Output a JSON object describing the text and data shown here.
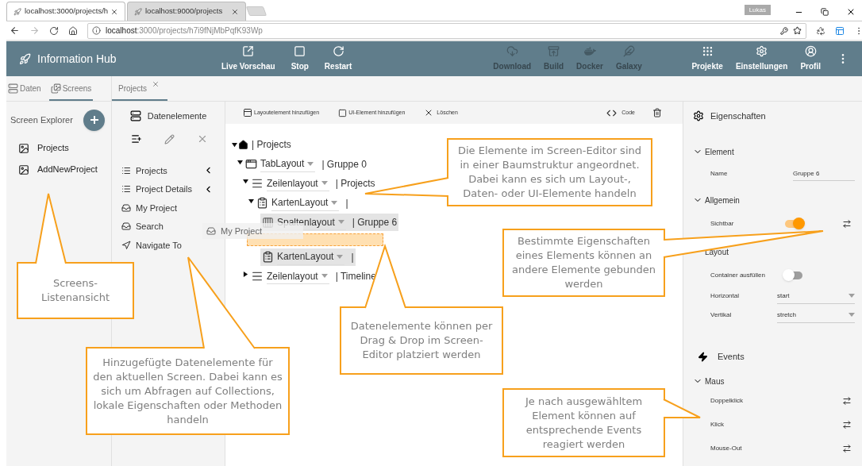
{
  "browser": {
    "tabs": [
      {
        "title": "localhost:3000/projects/h",
        "selected": true
      },
      {
        "title": "localhost:9000/projects",
        "selected": false
      }
    ],
    "profile": "Lukas",
    "url_host": "localhost",
    "url_path": ":3000/projects/h7i9fNjMbPqfK93Wp"
  },
  "app_bar": {
    "title": "Information Hub",
    "actions": [
      {
        "label": "Live Vorschau",
        "disabled": false
      },
      {
        "label": "Stop",
        "disabled": false
      },
      {
        "label": "Restart",
        "disabled": false
      },
      {
        "label": "Download",
        "disabled": true
      },
      {
        "label": "Build",
        "disabled": true
      },
      {
        "label": "Docker",
        "disabled": true
      },
      {
        "label": "Galaxy",
        "disabled": true
      },
      {
        "label": "Projekte",
        "disabled": false
      },
      {
        "label": "Einstellungen",
        "disabled": false
      },
      {
        "label": "Profil",
        "disabled": false
      }
    ]
  },
  "panel_tabs": [
    {
      "label": "Daten",
      "selected": false
    },
    {
      "label": "Screens",
      "selected": true
    }
  ],
  "editor_tabs": [
    {
      "label": "Projects",
      "selected": true
    }
  ],
  "screen_explorer": {
    "title": "Screen Explorer",
    "screens": [
      "Projects",
      "AddNewProject"
    ]
  },
  "data_elements": {
    "title": "Datenelemente",
    "items": [
      {
        "label": "Projects",
        "kind": "collection",
        "expandable": true
      },
      {
        "label": "Project Details",
        "kind": "collection",
        "expandable": true
      },
      {
        "label": "My Project",
        "kind": "object",
        "expandable": false
      },
      {
        "label": "Search",
        "kind": "object",
        "expandable": false
      },
      {
        "label": "Navigate To",
        "kind": "method",
        "expandable": false
      }
    ],
    "drag_ghost": "My Project"
  },
  "editor_toolbar": [
    "Layoutelement hinzufügen",
    "UI-Element hinzufügen",
    "Löschen",
    "Code"
  ],
  "tree": {
    "kind": "root",
    "label": "| Projects",
    "expanded": true,
    "children": [
      {
        "kind": "tab",
        "type": "TabLayout",
        "suffix": "| Gruppe 0",
        "expanded": true,
        "highlighted": false,
        "children": [
          {
            "kind": "rows",
            "type": "Zeilenlayout",
            "suffix": "| Projects",
            "expanded": true,
            "highlighted": false,
            "children": [
              {
                "kind": "card",
                "type": "KartenLayout",
                "suffix": "|",
                "expanded": true,
                "highlighted": false,
                "children": [
                  {
                    "kind": "columns",
                    "type": "Spaltenlayout",
                    "suffix": "| Gruppe 6",
                    "highlighted": true
                  },
                  {
                    "kind": "drop_zone"
                  },
                  {
                    "kind": "card",
                    "type": "KartenLayout",
                    "suffix": "|",
                    "highlighted": true
                  }
                ]
              }
            ]
          },
          {
            "kind": "rows",
            "type": "Zeilenlayout",
            "suffix": "| Timeline",
            "expanded": false,
            "highlighted": false
          }
        ]
      }
    ]
  },
  "properties": {
    "title": "Eigenschaften",
    "sections": [
      {
        "title": "Element",
        "expanded": true,
        "fields": [
          {
            "kind": "text",
            "label": "Name",
            "value": "Gruppe 6"
          }
        ]
      },
      {
        "title": "Allgemein",
        "expanded": true,
        "fields": [
          {
            "kind": "toggle",
            "label": "Sichtbar",
            "on": true,
            "bindable": true
          }
        ]
      },
      {
        "title": "Layout",
        "fields": [
          {
            "kind": "toggle",
            "label": "Container ausfüllen",
            "on": false,
            "bindable": false
          },
          {
            "kind": "select",
            "label": "Horizontal",
            "value": "start"
          },
          {
            "kind": "select",
            "label": "Vertikal",
            "value": "stretch"
          }
        ]
      }
    ],
    "events_title": "Events",
    "event_group": "Maus",
    "events": [
      "Doppelklick",
      "Klick",
      "Mouse-Out"
    ]
  },
  "callouts": [
    "Die Elemente im Screen-Editor sind in einer Baumstruktur angeordnet. Dabei kann es sich um Layout-, Daten- oder UI-Elemente handeln",
    "Bestimmte Eigenschaften eines Elements können an andere Elemente gebunden werden",
    "Screens-Listenansicht",
    "Hinzugefügte Datenelemente für den aktuellen Screen. Dabei kann es sich um Abfragen auf Collections, lokale Eigenschaften oder Methoden handeln",
    "Datenelemente können per Drag & Drop im Screen-Editor platziert werden",
    "Je nach ausgewähltem Element können auf entsprechende Events reagiert werden"
  ]
}
